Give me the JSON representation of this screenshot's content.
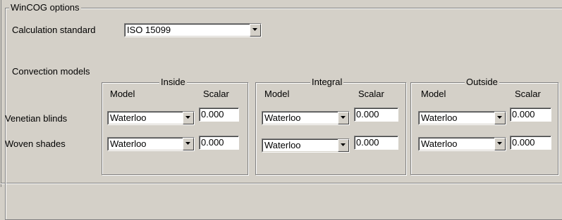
{
  "options_group": {
    "title": "WinCOG options"
  },
  "calculation_standard": {
    "label": "Calculation standard",
    "value": "ISO 15099"
  },
  "convection": {
    "title": "Convection models",
    "columns": {
      "model": "Model",
      "scalar": "Scalar"
    },
    "rows": [
      "Venetian blinds",
      "Woven shades"
    ],
    "groups": [
      {
        "title": "Inside",
        "values": [
          {
            "model": "Waterloo",
            "scalar": "0.000"
          },
          {
            "model": "Waterloo",
            "scalar": "0.000"
          }
        ]
      },
      {
        "title": "Integral",
        "values": [
          {
            "model": "Waterloo",
            "scalar": "0.000"
          },
          {
            "model": "Waterloo",
            "scalar": "0.000"
          }
        ]
      },
      {
        "title": "Outside",
        "values": [
          {
            "model": "Waterloo",
            "scalar": "0.000"
          },
          {
            "model": "Waterloo",
            "scalar": "0.000"
          }
        ]
      }
    ]
  }
}
